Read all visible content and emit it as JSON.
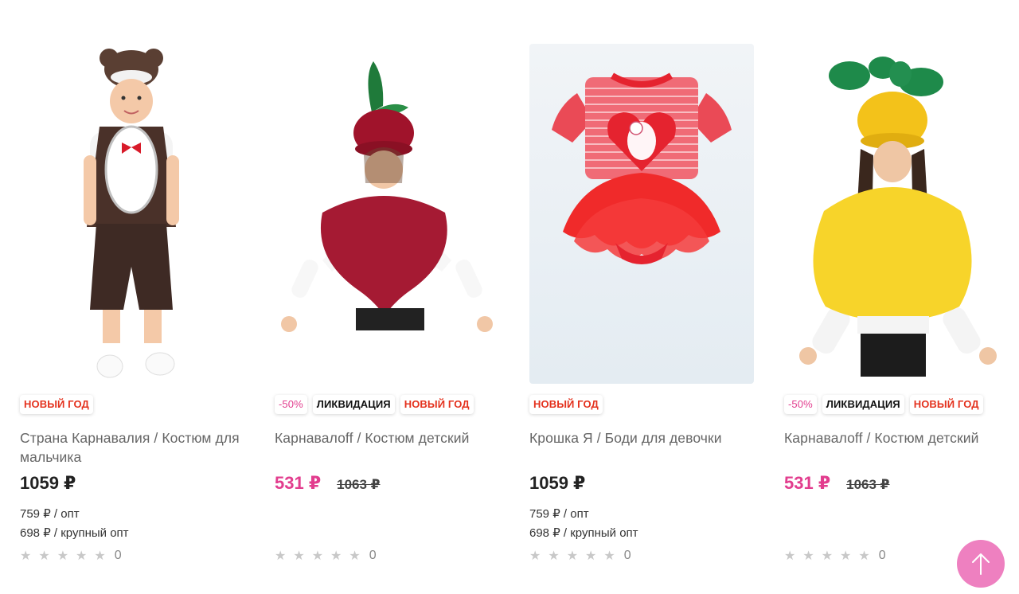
{
  "products": [
    {
      "badges": [
        "НОВЫЙ ГОД"
      ],
      "title": "Страна Карнавалия / Костюм для мальчика",
      "price": "1059 ₽",
      "opt": "759 ₽ / опт",
      "bulk": "698 ₽ / крупный опт",
      "rating_count": "0"
    },
    {
      "discount": "-50%",
      "liquidation": "ЛИКВИДАЦИЯ",
      "badges": [
        "НОВЫЙ ГОД"
      ],
      "title": "Карнавалоff / Костюм детский",
      "price": "531 ₽",
      "old_price": "1063 ₽",
      "rating_count": "0"
    },
    {
      "badges": [
        "НОВЫЙ ГОД"
      ],
      "title": "Крошка Я / Боди для девочки",
      "price": "1059 ₽",
      "opt": "759 ₽ / опт",
      "bulk": "698 ₽ / крупный опт",
      "rating_count": "0"
    },
    {
      "discount": "-50%",
      "liquidation": "ЛИКВИДАЦИЯ",
      "badges": [
        "НОВЫЙ ГОД"
      ],
      "title": "Карнавалоff / Костюм детский",
      "price": "531 ₽",
      "old_price": "1063 ₽",
      "rating_count": "0"
    }
  ],
  "icons": {
    "star": "star-icon",
    "scroll_top": "arrow-up-icon"
  },
  "colors": {
    "sale_price": "#e23d8e",
    "new_year_badge": "#e4321e",
    "scroll_top_bg": "#ee80c0",
    "star": "#c8c8c8"
  }
}
